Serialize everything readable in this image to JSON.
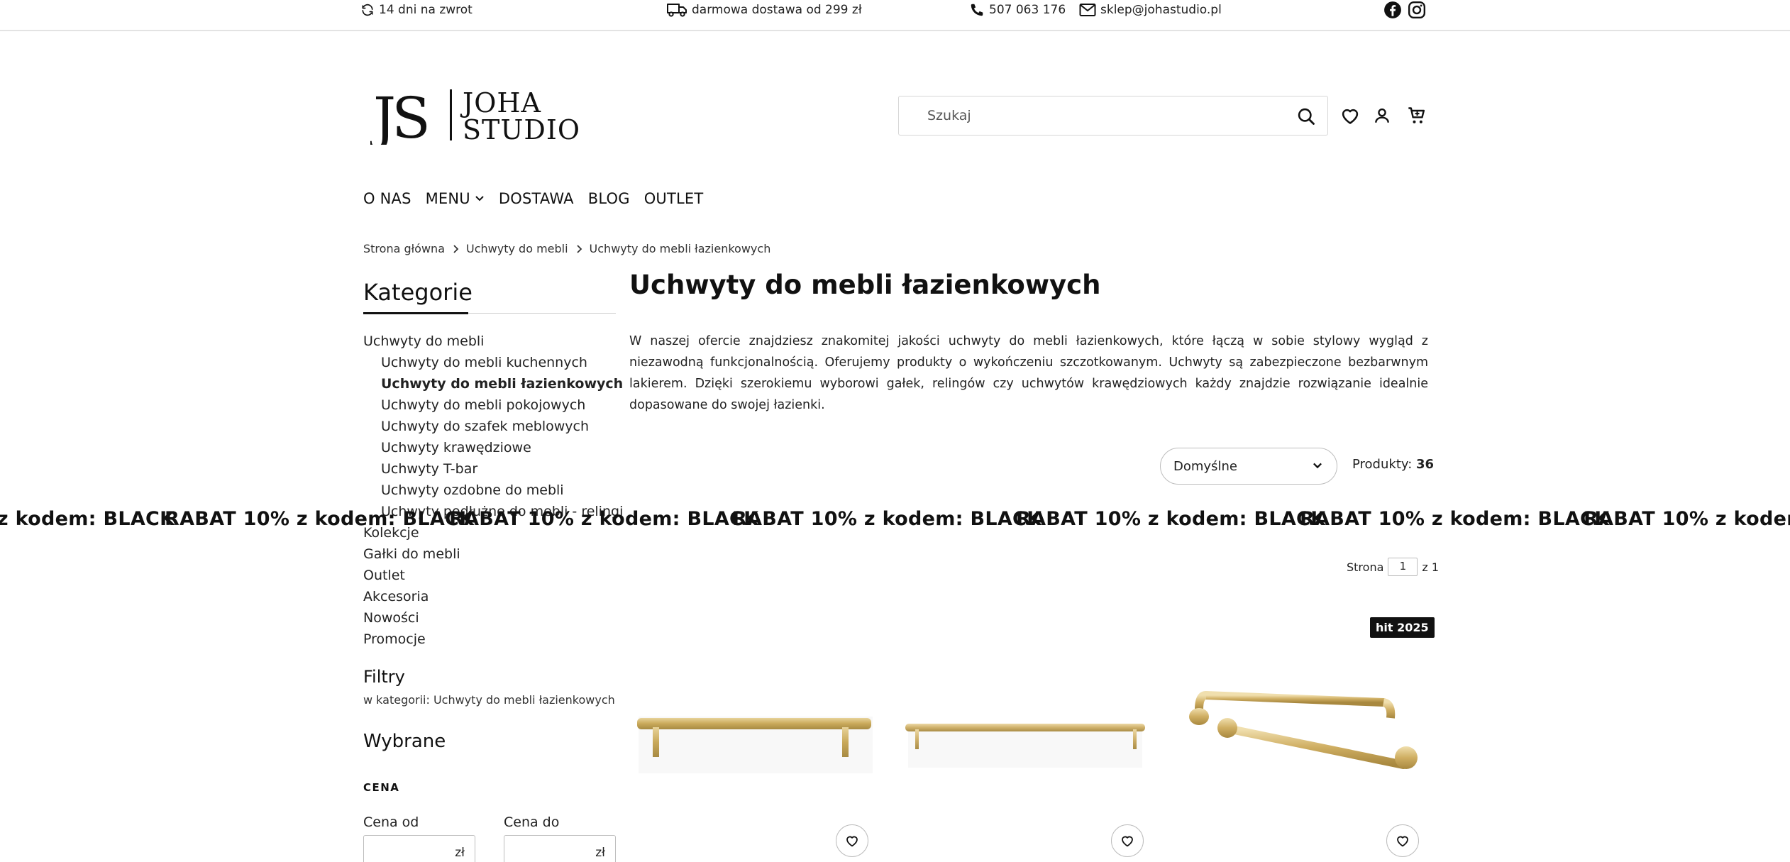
{
  "topbar": {
    "returns": "14 dni na zwrot",
    "shipping": "darmowa dostawa od 299 zł",
    "phone": "507 063 176",
    "email": "sklep@johastudio.pl",
    "social": [
      "facebook-icon",
      "instagram-icon"
    ]
  },
  "header": {
    "logo_text_mark": "JS",
    "logo_text_name_1": "JOHA",
    "logo_text_name_2": "STUDIO",
    "search_placeholder": "Szukaj",
    "icons": [
      "search-icon",
      "heart-icon",
      "user-icon",
      "cart-icon"
    ]
  },
  "nav": {
    "items": [
      "O NAS",
      "MENU",
      "DOSTAWA",
      "BLOG",
      "OUTLET"
    ]
  },
  "breadcrumb": [
    "Strona główna",
    "Uchwyty do mebli",
    "Uchwyty do mebli łazienkowych"
  ],
  "sidebar": {
    "title": "Kategorie",
    "categories": [
      "Uchwyty do mebli",
      "Uchwyty do mebli kuchennych",
      "Uchwyty do mebli łazienkowych",
      "Uchwyty do mebli pokojowych",
      "Uchwyty do szafek meblowych",
      "Uchwyty krawędziowe",
      "Uchwyty T-bar",
      "Uchwyty ozdobne do mebli",
      "Uchwyty podłużne do mebli - relingi",
      "Kolekcje",
      "Gałki do mebli",
      "Outlet",
      "Akcesoria",
      "Nowości",
      "Promocje"
    ],
    "filters_title": "Filtry",
    "filters_context": "w kategorii: Uchwyty do mebli łazienkowych",
    "selected_title": "Wybrane",
    "price_title": "CENA",
    "price_from_label": "Cena od",
    "price_to_label": "Cena do",
    "currency": "zł"
  },
  "main": {
    "title": "Uchwyty do mebli łazienkowych",
    "description": "W naszej ofercie znajdziesz znakomitej jakości uchwyty do mebli łazienkowych, które łączą w sobie stylowy wygląd z niezawodną funkcjonalnością. Oferujemy produkty o wykończeniu szczotkowanym. Uchwyty są zabezpieczone bezbarwnym lakierem. Dzięki szerokiemu wyborowi gałek, relingów czy uchwytów krawędziowych każdy znajdzie rozwiązanie idealnie dopasowane do swojej łazienki.",
    "sort_selected": "Domyślne",
    "products_label": "Produkty:",
    "products_count": "36",
    "page_label": "Strona",
    "page_value": "1",
    "page_of": "z 1",
    "badge": "hit 2025"
  },
  "banner": {
    "text": "RABAT 10% z kodem: BLACK"
  },
  "colors": {
    "text": "#111111",
    "border": "#bdbdbd",
    "badge_bg": "#111111",
    "product_gold": "#c9a95a"
  }
}
